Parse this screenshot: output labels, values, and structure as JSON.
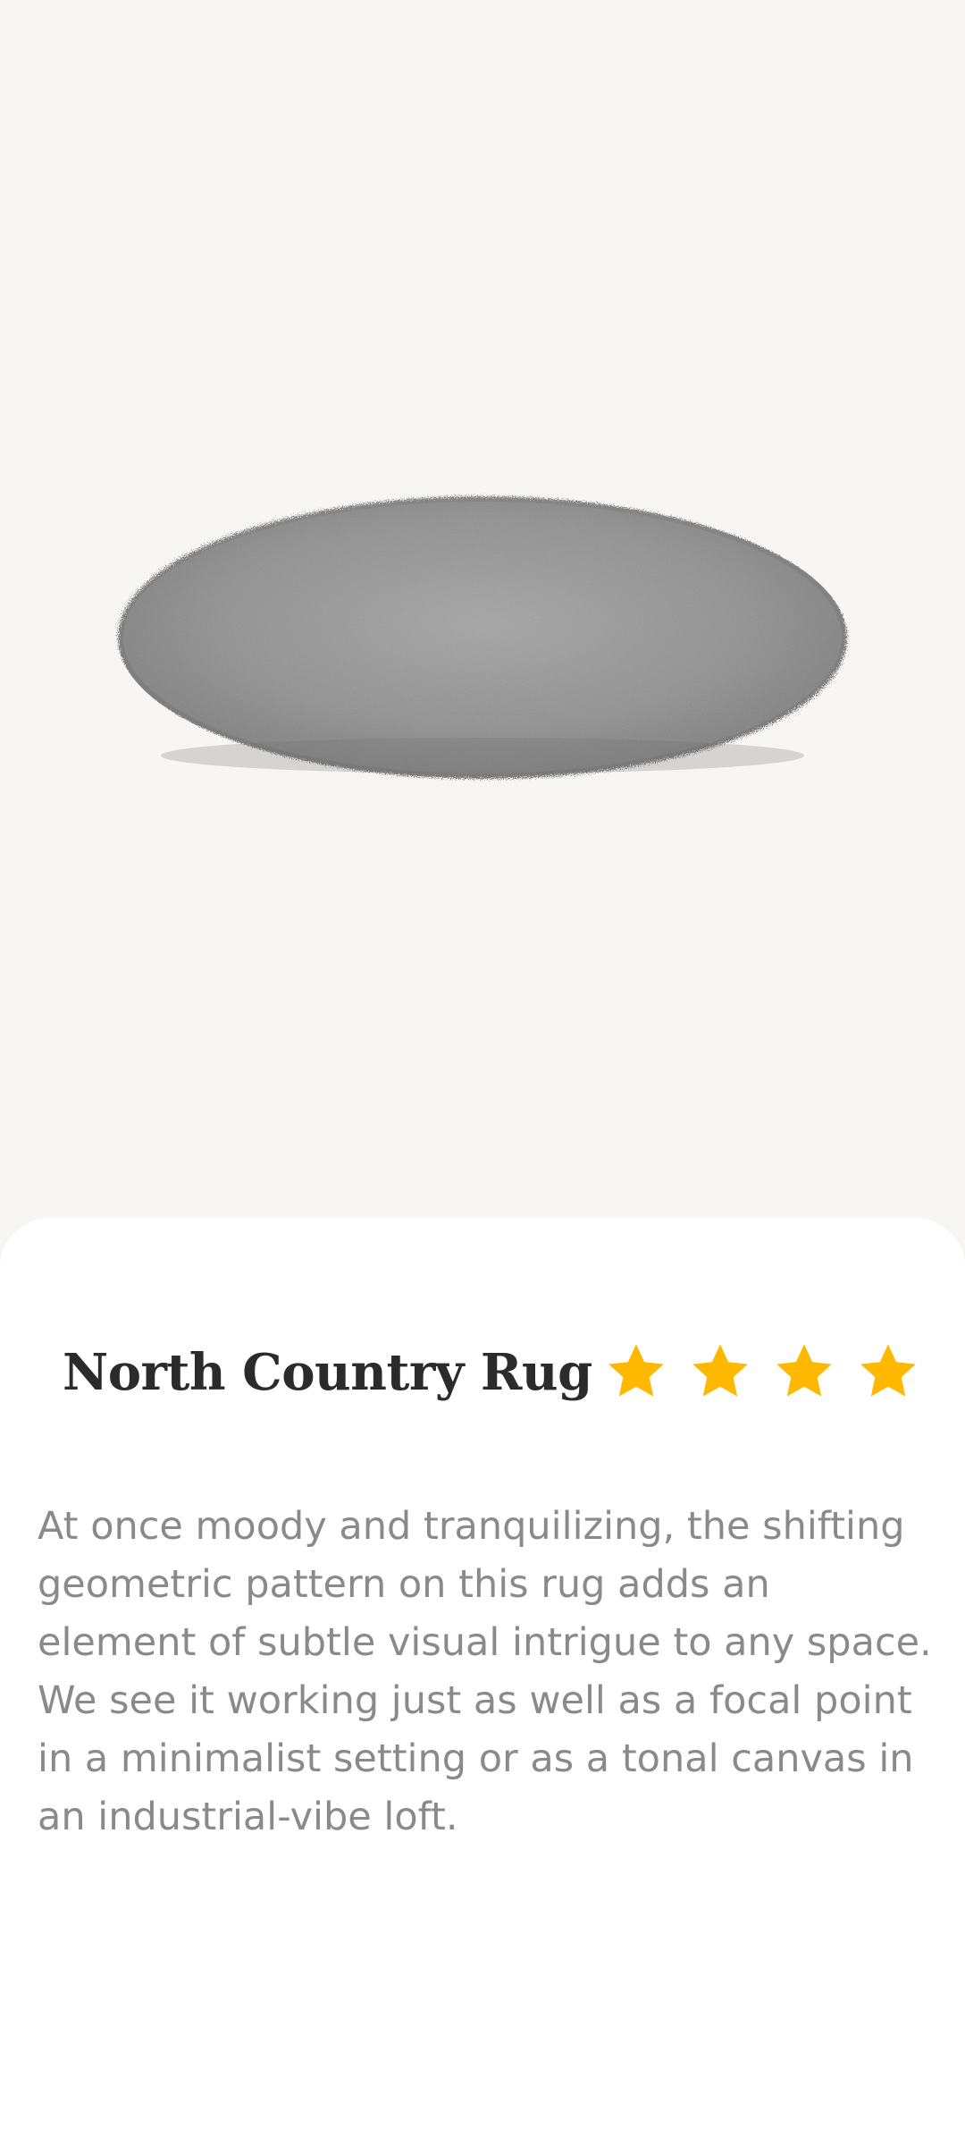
{
  "product": {
    "image_icon": "round-gray-shag-rug",
    "name": "North Country Rug",
    "rating": 4,
    "rating_max": 4,
    "star_color": "#FFB800",
    "description": "At once moody and tranquilizing, the shifting geometric pattern on this rug adds an element of subtle visual intrigue to any space. We see it working just as well as a focal point in a minimalist setting or as a tonal canvas in an industrial-vibe loft."
  },
  "colors": {
    "hero_background": "#F7F6F4",
    "sheet_background": "#FFFFFF",
    "title": "#2B2B2B",
    "body_text": "#8A8A8A"
  }
}
